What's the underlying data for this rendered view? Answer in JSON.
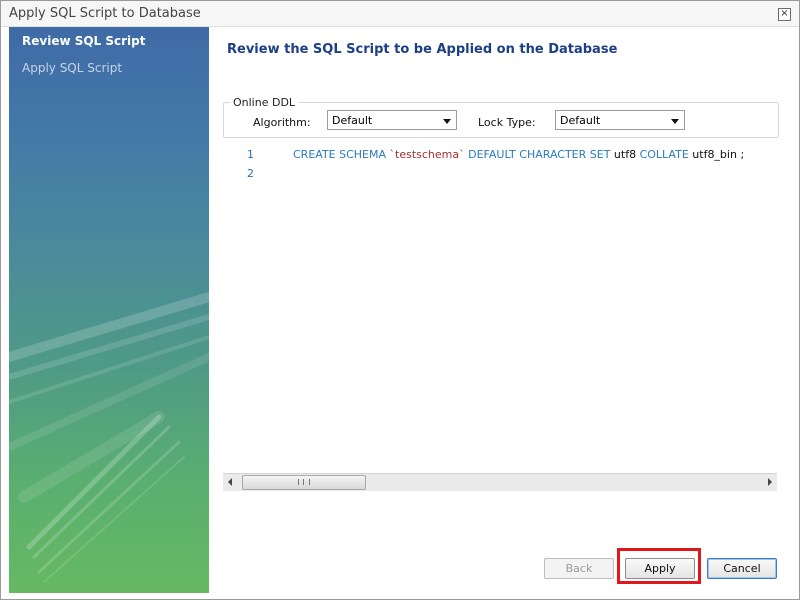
{
  "window": {
    "title": "Apply SQL Script to Database",
    "close_glyph": "⊠"
  },
  "sidebar": {
    "steps": [
      {
        "label": "Review SQL Script",
        "active": true
      },
      {
        "label": "Apply SQL Script",
        "active": false
      }
    ]
  },
  "main": {
    "heading": "Review the SQL Script to be Applied on the Database",
    "online_ddl": {
      "legend": "Online DDL",
      "algorithm_label": "Algorithm:",
      "algorithm_value": "Default",
      "lock_type_label": "Lock Type:",
      "lock_type_value": "Default"
    },
    "editor": {
      "line_numbers": [
        "1",
        "2"
      ],
      "line1_tokens": {
        "create_schema": "CREATE SCHEMA",
        "schema_name": "`testschema`",
        "default_charset": "DEFAULT CHARACTER SET",
        "charset": "utf8",
        "collate": "COLLATE",
        "collation": "utf8_bin",
        "terminator": ";"
      }
    },
    "scrollbar": {
      "grip_glyph": ""
    }
  },
  "footer": {
    "back_label": "Back",
    "apply_label": "Apply",
    "cancel_label": "Cancel"
  },
  "colors": {
    "highlight": "#e2161b",
    "heading": "#1d3f86",
    "keyword": "#2a7bc0",
    "string": "#a0322e"
  }
}
